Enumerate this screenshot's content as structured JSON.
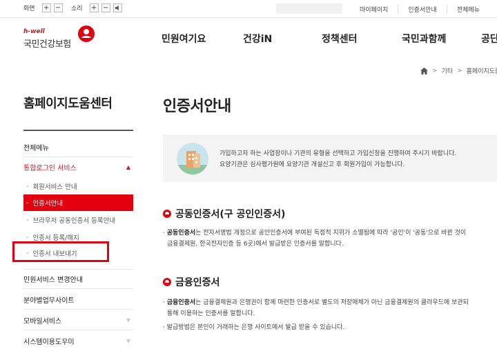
{
  "topbar": {
    "screen_label": "화면",
    "sound_label": "소리",
    "plus": "+",
    "minus": "−",
    "links": [
      "마이페이지",
      "인증서안내",
      "전체메뉴"
    ]
  },
  "logo": {
    "tag": "h-well",
    "name": "국민건강보험"
  },
  "gnb": [
    "민원여기요",
    "건강iN",
    "정책센터",
    "국민과함께",
    "공단"
  ],
  "breadcrumb": [
    "기타",
    "홈페이지도움"
  ],
  "sidebar": {
    "title": "홈페이지도움센터",
    "all_menu": "전체메뉴",
    "login_services": "통합로그인 서비스",
    "sub_items": [
      "회원서비스 안내",
      "인증서안내",
      "브라우저 공동인증서 등록안내",
      "인증서 등록/해지",
      "인증서 내보내기"
    ],
    "items_after": [
      "민원서비스 변경안내",
      "분야별업무사이트",
      "모바일서비스",
      "시스템이용도우미"
    ]
  },
  "main": {
    "title": "인증서안내",
    "info_line1": "가입하고자 하는 사업장이나 기관의 유형을 선택하고 가입신청을 진행하여 주시기 바랍니다.",
    "info_line2": "요양기관은 심사평가원에 요양기관 개설신고 후 회원가입이 가능합니다.",
    "section1_title": "공동인증서(구 공인인증서)",
    "section1_term": "공동인증서",
    "section1_line1": "는 전자서명법 개정으로 공인인증서에 부여된 독점적 지위가 소멸됨에 따라 '공인'이 '공동'으로 바뀐 것이",
    "section1_line2": "금융결제원, 한국전자인증 등 6곳)에서 발급받은 인증서를 말합니다.",
    "section2_title": "금융인증서",
    "section2_term": "금융인증서",
    "section2_line1": "는 금융결제원과 은행권이 함께 마련한 인증서로 별도의 저장매체가 아닌 금융결제원의 클라우드에 보관되",
    "section2_line2": "통해 이용하는 인증서를 말합니다.",
    "section2_line3": "발급방법은 본인이 거래하는 은행 사이트에서 발급 받을 수 있습니다."
  },
  "colors": {
    "accent": "#e3000f",
    "brand": "#d7141a"
  }
}
